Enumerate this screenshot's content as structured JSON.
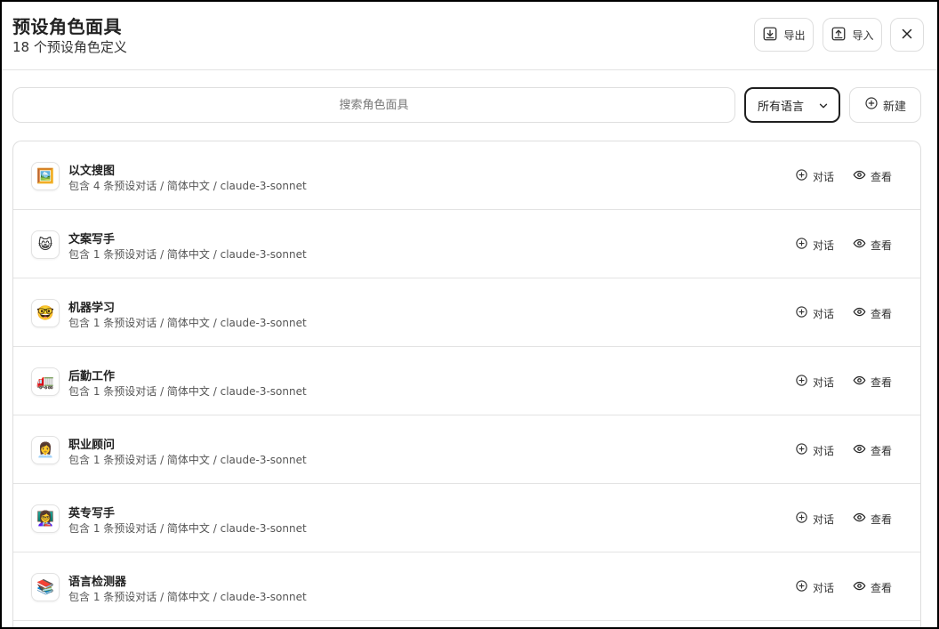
{
  "header": {
    "title": "预设角色面具",
    "subtitle": "18 个预设角色定义",
    "export_label": "导出",
    "import_label": "导入"
  },
  "toolbar": {
    "search_placeholder": "搜索角色面具",
    "language_selected": "所有语言",
    "new_label": "新建"
  },
  "masks": [
    {
      "emoji": "🖼️",
      "name": "以文搜图",
      "description": "包含 4 条预设对话 / 简体中文 / claude-3-sonnet",
      "chat_label": "对话",
      "view_label": "查看"
    },
    {
      "emoji": "😸",
      "name": "文案写手",
      "description": "包含 1 条预设对话 / 简体中文 / claude-3-sonnet",
      "chat_label": "对话",
      "view_label": "查看"
    },
    {
      "emoji": "🤓",
      "name": "机器学习",
      "description": "包含 1 条预设对话 / 简体中文 / claude-3-sonnet",
      "chat_label": "对话",
      "view_label": "查看"
    },
    {
      "emoji": "🚛",
      "name": "后勤工作",
      "description": "包含 1 条预设对话 / 简体中文 / claude-3-sonnet",
      "chat_label": "对话",
      "view_label": "查看"
    },
    {
      "emoji": "👩‍💼",
      "name": "职业顾问",
      "description": "包含 1 条预设对话 / 简体中文 / claude-3-sonnet",
      "chat_label": "对话",
      "view_label": "查看"
    },
    {
      "emoji": "👩‍🏫",
      "name": "英专写手",
      "description": "包含 1 条预设对话 / 简体中文 / claude-3-sonnet",
      "chat_label": "对话",
      "view_label": "查看"
    },
    {
      "emoji": "📚",
      "name": "语言检测器",
      "description": "包含 1 条预设对话 / 简体中文 / claude-3-sonnet",
      "chat_label": "对话",
      "view_label": "查看"
    }
  ],
  "icons": {
    "export": "download-icon",
    "import": "upload-icon",
    "close": "close-icon",
    "new": "add-circle-icon",
    "chat": "add-circle-icon",
    "view": "eye-icon",
    "select": "chevron-down-icon"
  }
}
